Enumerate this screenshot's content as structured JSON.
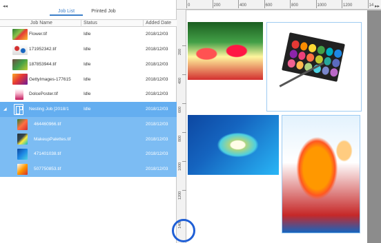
{
  "left_panel": {
    "collapse_glyph": "◂◂",
    "tabs": [
      {
        "label": "Job List",
        "active": true
      },
      {
        "label": "Printed Job",
        "active": false
      }
    ],
    "columns": [
      "Job Name",
      "Status",
      "Added Date"
    ],
    "rows": [
      {
        "name": "Flower.tif",
        "status": "Idle",
        "date": "2018/12/03",
        "thumb": "flower",
        "selected": false,
        "child": false
      },
      {
        "name": "171952342.tif",
        "status": "Idle",
        "date": "2018/12/03",
        "thumb": "dots",
        "selected": false,
        "child": false
      },
      {
        "name": "187853944.tif",
        "status": "Idle",
        "date": "2018/12/03",
        "thumb": "plant",
        "selected": false,
        "child": false
      },
      {
        "name": "GettyImages-177615",
        "status": "Idle",
        "date": "2018/12/03",
        "thumb": "getty",
        "selected": false,
        "child": false
      },
      {
        "name": "DolcePoster.tif",
        "status": "Idle",
        "date": "2018/12/03",
        "thumb": "dolce",
        "selected": false,
        "child": false
      },
      {
        "name": "Nesting Job [2018/1",
        "status": "Idle",
        "date": "2018/12/03",
        "thumb": "nest",
        "selected": true,
        "child": false,
        "expander": "◢"
      },
      {
        "name": "464460966.tif",
        "status": "",
        "date": "2018/12/03",
        "thumb": "drinks",
        "selected": true,
        "child": true
      },
      {
        "name": "MakeupPalettes.tif",
        "status": "",
        "date": "2018/12/03",
        "thumb": "palette",
        "selected": true,
        "child": true
      },
      {
        "name": "471401038.tif",
        "status": "",
        "date": "2018/12/03",
        "thumb": "island",
        "selected": true,
        "child": true
      },
      {
        "name": "507750853.tif",
        "status": "",
        "date": "2018/12/03",
        "thumb": "juice",
        "selected": true,
        "child": true
      }
    ]
  },
  "preview": {
    "expand_glyph": "▸▸",
    "ruler_top": [
      "0",
      "200",
      "400",
      "600",
      "800",
      "1000",
      "1200",
      "14"
    ],
    "ruler_left": [
      "200",
      "400",
      "600",
      "800",
      "1000",
      "1200",
      "1400"
    ],
    "colors": {
      "selection": "#64aef0",
      "canvas": "#ffffff",
      "margin": "#8c8c8c",
      "highlight_ring": "#1f5fd6"
    },
    "palette_swatches": [
      "#e53935",
      "#fb8c00",
      "#fdd835",
      "#43a047",
      "#00acc1",
      "#1e88e5",
      "#8e24aa",
      "#ec407a",
      "#ff7043",
      "#c0ca33",
      "#26a69a",
      "#5c6bc0",
      "#f06292",
      "#ffb74d",
      "#aed581",
      "#4dd0e1",
      "#7986cb",
      "#ba68c8"
    ]
  }
}
